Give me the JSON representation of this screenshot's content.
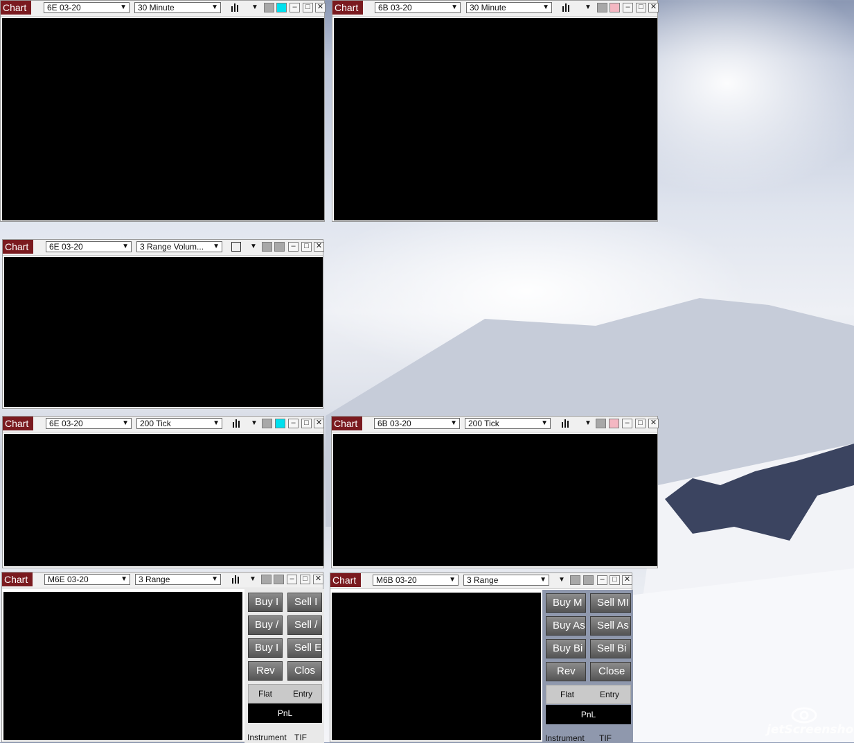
{
  "windows": [
    {
      "id": "w1",
      "tab": "Chart",
      "instrument": "6E 03-20",
      "interval": "30 Minute",
      "color_swatch": "#00e0ee"
    },
    {
      "id": "w2",
      "tab": "Chart",
      "instrument": "6B 03-20",
      "interval": "30 Minute",
      "color_swatch": "#f4b7c2"
    },
    {
      "id": "w3",
      "tab": "Chart",
      "instrument": "6E 03-20",
      "interval": "3 Range Volum...",
      "color_swatch": "#a8a8a8"
    },
    {
      "id": "w4",
      "tab": "Chart",
      "instrument": "6E 03-20",
      "interval": "200 Tick",
      "color_swatch": "#00e0ee"
    },
    {
      "id": "w5",
      "tab": "Chart",
      "instrument": "6B 03-20",
      "interval": "200 Tick",
      "color_swatch": "#f4b7c2"
    },
    {
      "id": "w6",
      "tab": "Chart",
      "instrument": "M6E 03-20",
      "interval": "3 Range",
      "color_swatch": "#a8a8a8"
    },
    {
      "id": "w7",
      "tab": "Chart",
      "instrument": "M6B 03-20",
      "interval": "3 Range",
      "color_swatch": "#a8a8a8"
    }
  ],
  "panel_small": {
    "buy_market": "Buy I",
    "sell_market": "Sell I",
    "buy_ask": "Buy /",
    "sell_ask": "Sell /",
    "buy_bid": "Buy I",
    "sell_bid": "Sell E",
    "rev": "Rev",
    "close": "Clos",
    "flat": "Flat",
    "entry": "Entry",
    "pnl": "PnL",
    "instrument": "Instrument",
    "tif": "TIF"
  },
  "panel_large": {
    "buy_market": "Buy M",
    "sell_market": "Sell MI",
    "buy_ask": "Buy As",
    "sell_ask": "Sell As",
    "buy_bid": "Buy Bi",
    "sell_bid": "Sell Bi",
    "rev": "Rev",
    "close": "Close",
    "flat": "Flat",
    "entry": "Entry",
    "pnl": "PnL",
    "instrument": "Instrument",
    "tif": "TIF"
  },
  "watermark": "jetScreenshot",
  "colors": {
    "tab": "#7a1a1f",
    "canvas": "#000000"
  }
}
